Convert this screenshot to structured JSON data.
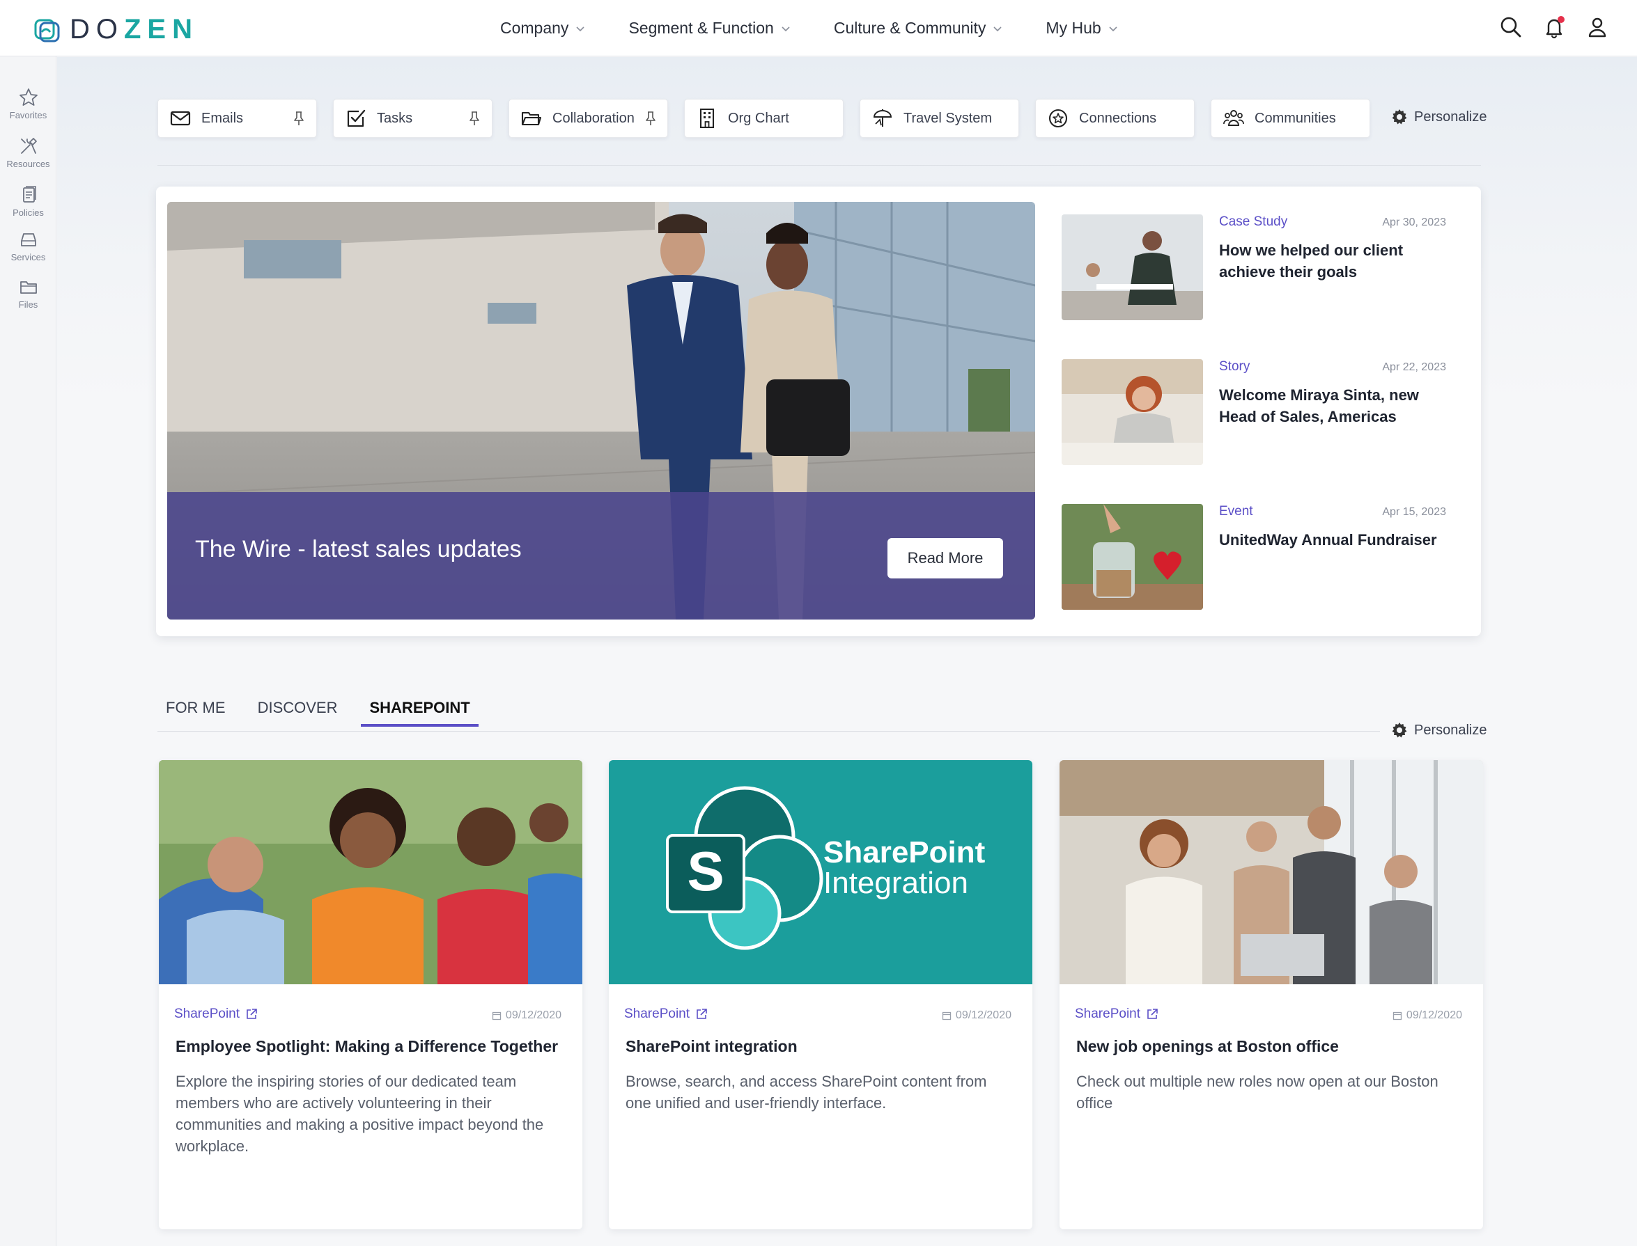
{
  "app": {
    "logo_prefix": "DO",
    "logo_suffix": "ZEN",
    "accent": "#1aa6a2",
    "brand_purple": "#5b4fc7"
  },
  "nav": {
    "items": [
      {
        "label": "Company"
      },
      {
        "label": "Segment & Function"
      },
      {
        "label": "Culture & Community"
      },
      {
        "label": "My Hub"
      }
    ]
  },
  "rail": {
    "items": [
      {
        "label": "Favorites",
        "icon": "star-icon"
      },
      {
        "label": "Resources",
        "icon": "tools-icon"
      },
      {
        "label": "Policies",
        "icon": "document-icon"
      },
      {
        "label": "Services",
        "icon": "inbox-icon"
      },
      {
        "label": "Files",
        "icon": "folder-icon"
      }
    ]
  },
  "quicklinks": {
    "items": [
      {
        "label": "Emails",
        "icon": "mail-icon",
        "pinned": true
      },
      {
        "label": "Tasks",
        "icon": "checkbox-icon",
        "pinned": true
      },
      {
        "label": "Collaboration",
        "icon": "folder-open-icon",
        "pinned": true
      },
      {
        "label": "Org Chart",
        "icon": "building-icon",
        "pinned": false
      },
      {
        "label": "Travel System",
        "icon": "travel-icon",
        "pinned": false
      },
      {
        "label": "Connections",
        "icon": "star-circle-icon",
        "pinned": false
      },
      {
        "label": "Communities",
        "icon": "people-icon",
        "pinned": false
      }
    ],
    "personalize": "Personalize"
  },
  "hero": {
    "title": "The Wire - latest sales updates",
    "button": "Read More"
  },
  "news": [
    {
      "category": "Case Study",
      "date": "Apr 30, 2023",
      "title": "How we helped our client achieve their goals"
    },
    {
      "category": "Story",
      "date": "Apr 22, 2023",
      "title": "Welcome Miraya Sinta, new Head of Sales, Americas"
    },
    {
      "category": "Event",
      "date": "Apr 15, 2023",
      "title": "UnitedWay Annual Fundraiser"
    }
  ],
  "tabs": {
    "items": [
      "FOR ME",
      "DISCOVER",
      "SHAREPOINT"
    ],
    "active": "SHAREPOINT",
    "personalize": "Personalize"
  },
  "cards": [
    {
      "source": "SharePoint",
      "date": "09/12/2020",
      "title": "Employee Spotlight: Making a Difference Together",
      "desc": "Explore the inspiring stories of our dedicated team members who are actively volunteering in their communities and making a positive impact beyond the workplace."
    },
    {
      "source": "SharePoint",
      "date": "09/12/2020",
      "title": "SharePoint integration",
      "desc": "Browse, search, and access SharePoint content from one unified and user-friendly interface.",
      "banner_line1": "SharePoint",
      "banner_line2": "Integration",
      "banner_letter": "S"
    },
    {
      "source": "SharePoint",
      "date": "09/12/2020",
      "title": "New job openings at Boston office",
      "desc": "Check out multiple new roles now open at our Boston office"
    }
  ]
}
